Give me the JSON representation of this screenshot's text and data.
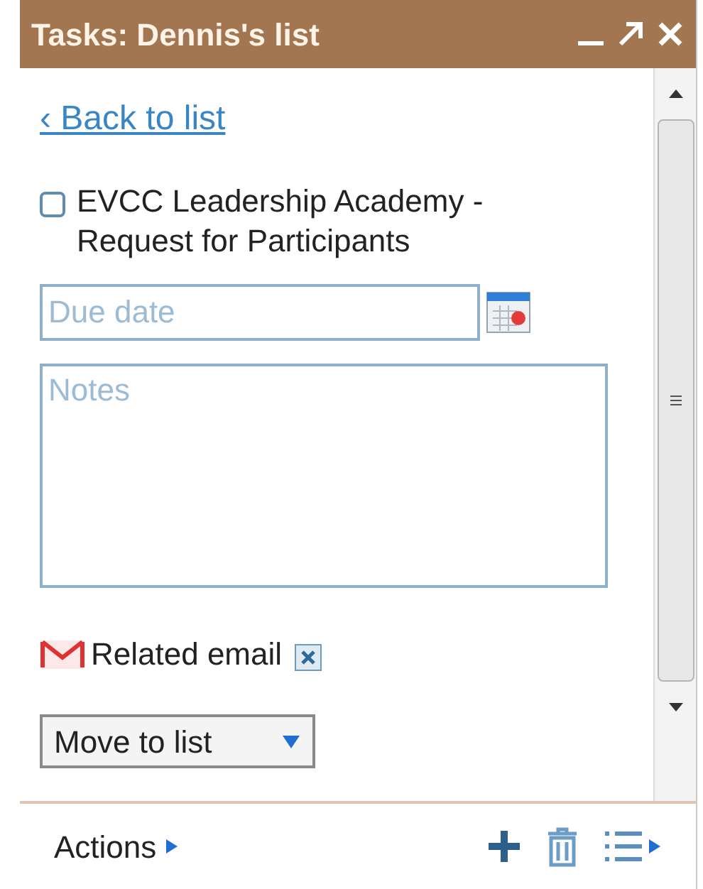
{
  "window": {
    "title": "Tasks: Dennis's list"
  },
  "back_link": "‹ Back to list",
  "task": {
    "title": "EVCC Leadership Academy - Request for Participants",
    "checked": false
  },
  "due_date": {
    "placeholder": "Due date"
  },
  "notes": {
    "placeholder": "Notes"
  },
  "related_email": {
    "label": "Related email"
  },
  "move_to_list": {
    "label": "Move to list"
  },
  "footer": {
    "actions": "Actions"
  }
}
